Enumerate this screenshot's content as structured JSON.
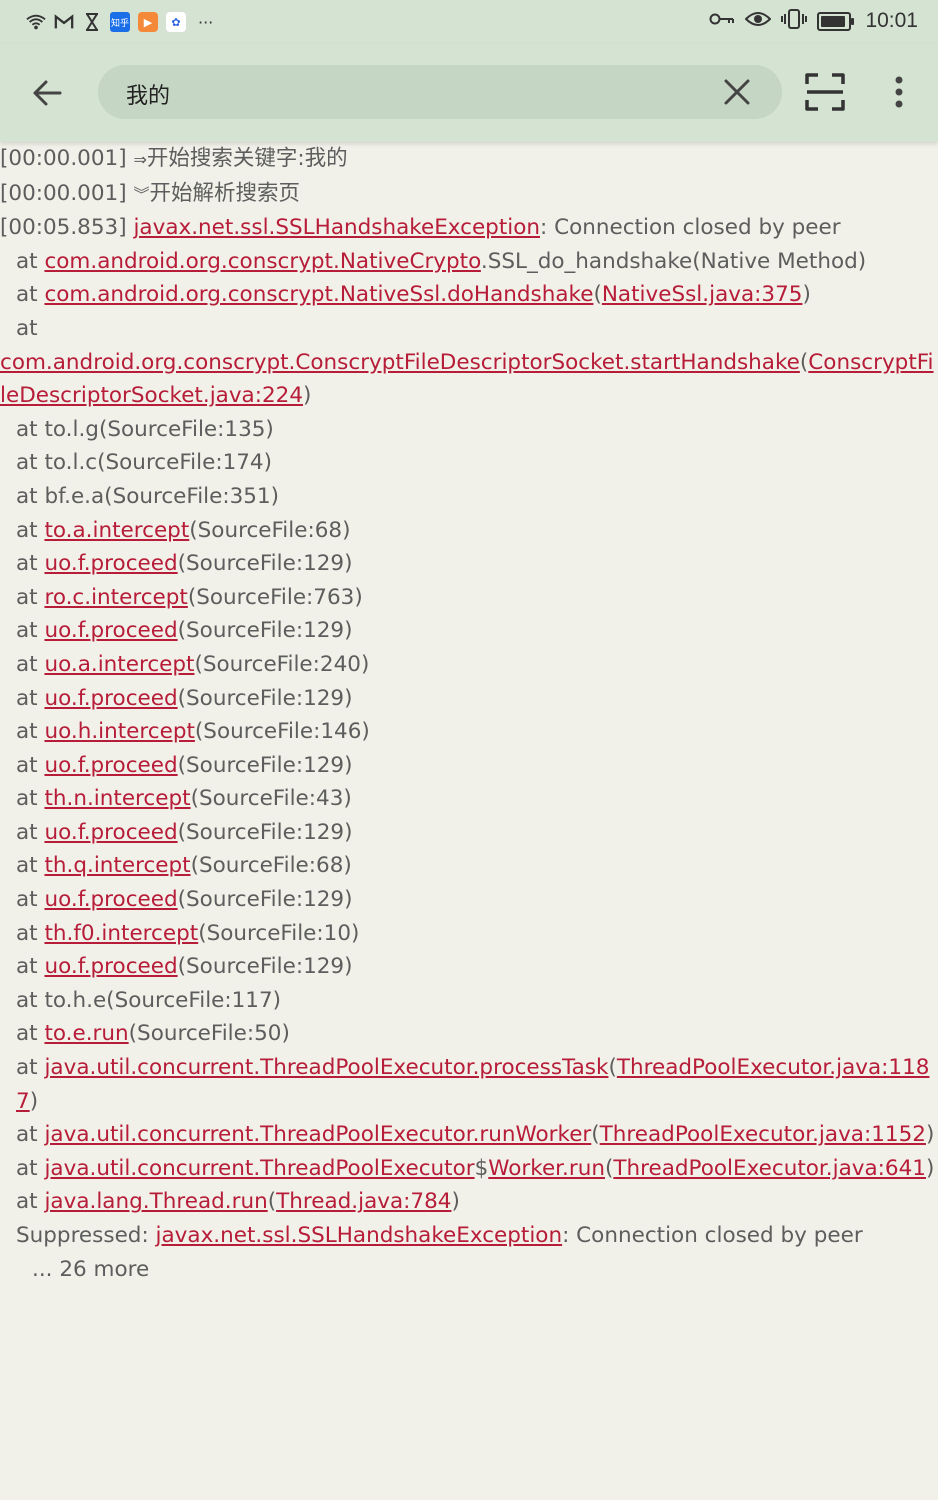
{
  "statusbar": {
    "time": "10:01",
    "left_icons": [
      "wifi-icon",
      "gmail-icon",
      "hourglass-icon",
      "zhihu-app-icon",
      "video-app-icon",
      "baidu-app-icon"
    ],
    "zhihu_label": "知乎",
    "more_label": "···"
  },
  "toolbar": {
    "search_value": "我的"
  },
  "log": {
    "l1_time": "[00:00.001]",
    "l1_mark": "⇒",
    "l1_text": "开始搜索关键字:我的",
    "l2_time": "[00:00.001]",
    "l2_mark": "︾",
    "l2_text": "开始解析搜索页",
    "l3_time": "[00:05.853]",
    "l3_link": "javax.net.ssl.SSLHandshakeException",
    "l3_text": ": Connection closed by peer",
    "at": "at",
    "f1_link": "com.android.org.conscrypt.NativeCrypto",
    "f1_text": ".SSL_do_handshake(Native Method)",
    "f2_link": "com.android.org.conscrypt.NativeSsl.doHandshake",
    "f2_paren_open": "(",
    "f2_src": "NativeSsl.java:375",
    "f2_paren_close": ")",
    "f3_link": "com.android.org.conscrypt.ConscryptFileDescriptorSocket.startHandshake",
    "f3_src": "ConscryptFileDescriptorSocket.java:224",
    "f4": "to.l.g(SourceFile:135)",
    "f5": "to.l.c(SourceFile:174)",
    "f6": "bf.e.a(SourceFile:351)",
    "frames": [
      {
        "link": "to.a.intercept",
        "src": "(SourceFile:68)"
      },
      {
        "link": "uo.f.proceed",
        "src": "(SourceFile:129)"
      },
      {
        "link": "ro.c.intercept",
        "src": "(SourceFile:763)"
      },
      {
        "link": "uo.f.proceed",
        "src": "(SourceFile:129)"
      },
      {
        "link": "uo.a.intercept",
        "src": "(SourceFile:240)"
      },
      {
        "link": "uo.f.proceed",
        "src": "(SourceFile:129)"
      },
      {
        "link": "uo.h.intercept",
        "src": "(SourceFile:146)"
      },
      {
        "link": "uo.f.proceed",
        "src": "(SourceFile:129)"
      },
      {
        "link": "th.n.intercept",
        "src": "(SourceFile:43)"
      },
      {
        "link": "uo.f.proceed",
        "src": "(SourceFile:129)"
      },
      {
        "link": "th.q.intercept",
        "src": "(SourceFile:68)"
      },
      {
        "link": "uo.f.proceed",
        "src": "(SourceFile:129)"
      },
      {
        "link": "th.f0.intercept",
        "src": "(SourceFile:10)"
      },
      {
        "link": "uo.f.proceed",
        "src": "(SourceFile:129)"
      }
    ],
    "f7": "to.h.e(SourceFile:117)",
    "f8_link": "to.e.run",
    "f8_text": "(SourceFile:50)",
    "f9_link": "java.util.concurrent.ThreadPoolExecutor.processTask",
    "f9_src": "ThreadPoolExecutor.java:1187",
    "f10_link": "java.util.concurrent.ThreadPoolExecutor.runWorker",
    "f10_src": "ThreadPoolExecutor.java:1152",
    "f11_link_a": "java.util.concurrent.ThreadPoolExecutor",
    "f11_dollar": "$",
    "f11_link_b": "Worker.run",
    "f11_src": "ThreadPoolExecutor.java:641",
    "f12_link": "java.lang.Thread.run",
    "f12_src": "Thread.java:784",
    "suppressed_label": "Suppressed: ",
    "suppressed_link": "javax.net.ssl.SSLHandshakeException",
    "suppressed_text": ": Connection closed by peer",
    "more": "... 26 more"
  },
  "colors": {
    "bar_bg": "#d5e3d3",
    "search_bg": "#c6d6c4",
    "page_bg": "#f1f1e9",
    "link": "#b71c38",
    "text": "#5d5d5d"
  }
}
